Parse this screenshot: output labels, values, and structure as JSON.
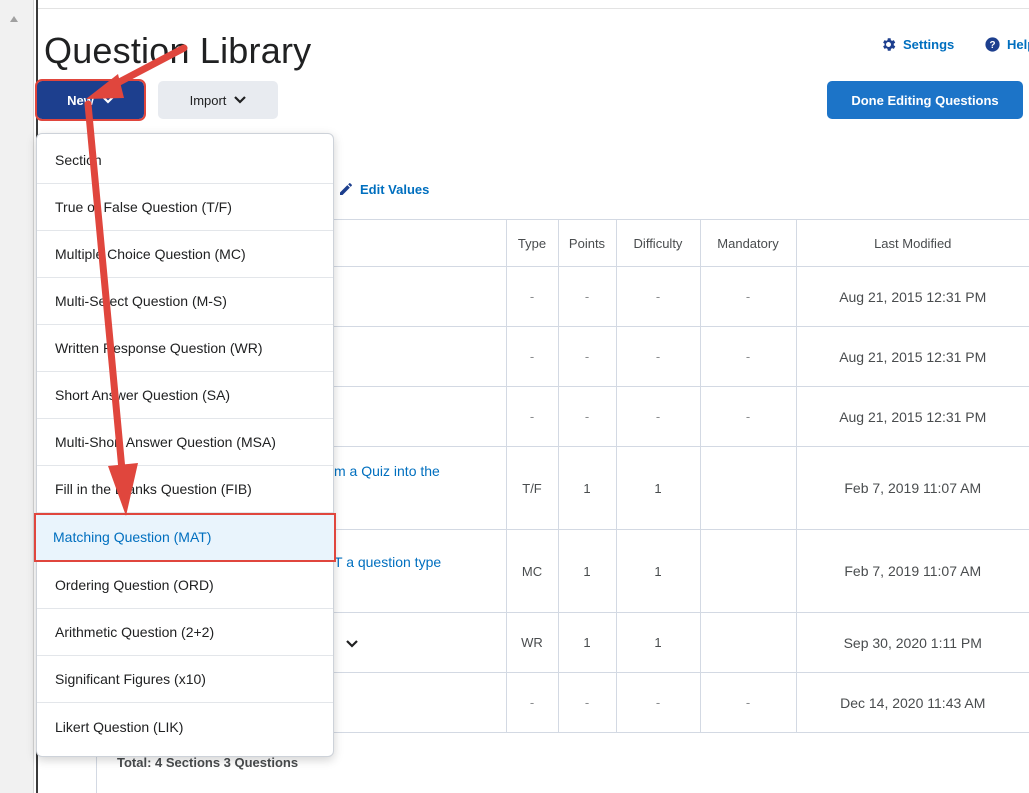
{
  "header": {
    "title": "Question Library",
    "settings_label": "Settings",
    "help_label": "Help"
  },
  "toolbar": {
    "new_label": "New",
    "import_label": "Import",
    "done_label": "Done Editing Questions",
    "edit_values_label": "Edit Values"
  },
  "table": {
    "columns": [
      "Type",
      "Points",
      "Difficulty",
      "Mandatory",
      "Last Modified"
    ],
    "rows": [
      {
        "name": "",
        "type": "-",
        "points": "-",
        "difficulty": "-",
        "mandatory": "-",
        "modified": "Aug 21, 2015 12:31 PM"
      },
      {
        "name": "",
        "type": "-",
        "points": "-",
        "difficulty": "-",
        "mandatory": "-",
        "modified": "Aug 21, 2015 12:31 PM"
      },
      {
        "name": "",
        "type": "-",
        "points": "-",
        "difficulty": "-",
        "mandatory": "-",
        "modified": "Aug 21, 2015 12:31 PM"
      },
      {
        "name": "m a Quiz into the",
        "type": "T/F",
        "points": "1",
        "difficulty": "1",
        "mandatory": "",
        "modified": "Feb 7, 2019 11:07 AM"
      },
      {
        "name": "T a question type",
        "type": "MC",
        "points": "1",
        "difficulty": "1",
        "mandatory": "",
        "modified": "Feb 7, 2019 11:07 AM"
      },
      {
        "name": "",
        "type": "WR",
        "points": "1",
        "difficulty": "1",
        "mandatory": "",
        "modified": "Sep 30, 2020 1:11 PM"
      },
      {
        "name": "",
        "type": "-",
        "points": "-",
        "difficulty": "-",
        "mandatory": "-",
        "modified": "Dec 14, 2020 11:43 AM"
      }
    ],
    "total": "Total: 4 Sections  3 Questions"
  },
  "new_menu": {
    "items": [
      "Section",
      "True or False Question (T/F)",
      "Multiple Choice Question (MC)",
      "Multi-Select Question (M-S)",
      "Written Response Question (WR)",
      "Short Answer Question (SA)",
      "Multi-Short Answer Question (MSA)",
      "Fill in the Blanks Question (FIB)",
      "Matching Question (MAT)",
      "Ordering Question (ORD)",
      "Arithmetic Question (2+2)",
      "Significant Figures (x10)",
      "Likert Question (LIK)"
    ],
    "active_index": 8
  },
  "colors": {
    "primary": "#1d3f8e",
    "done_button": "#1c74c8",
    "link": "#006fbf",
    "annotation": "#e0463d"
  },
  "icons": {
    "settings": "gear-icon",
    "help": "help-circle-icon",
    "dropdown": "chevron-down-icon",
    "edit": "pencil-icon"
  }
}
